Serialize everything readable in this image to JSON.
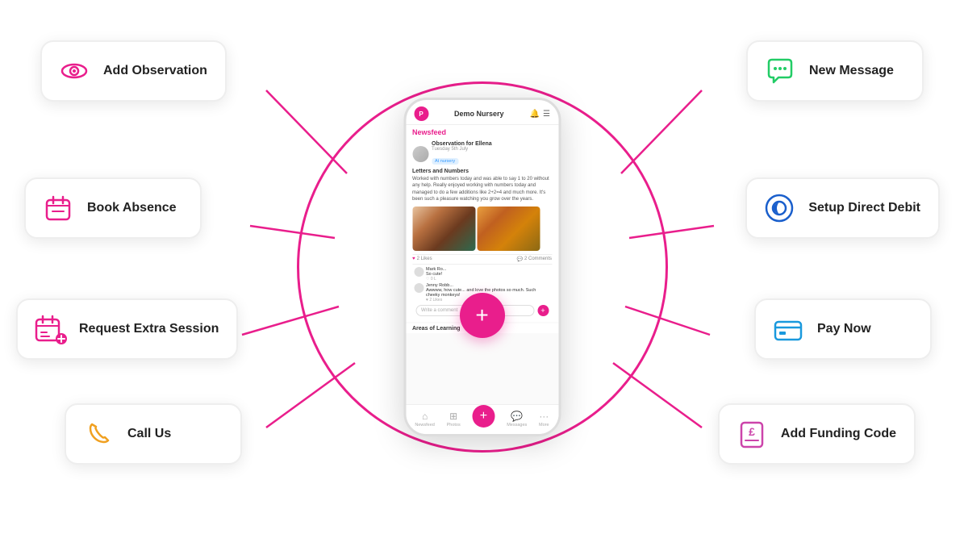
{
  "app": {
    "title": "Demo Nursery",
    "logo": "P"
  },
  "phone": {
    "newsfeed_label": "Newsfeed",
    "observation": {
      "name": "Observation for Ellena",
      "date": "Tuesday 5th July",
      "tag": "At nursery",
      "title": "Letters and Numbers",
      "text": "Worked with numbers today and was able to say 1 to 20 without any help. Really enjoyed working with numbers today and managed to do a few additions like 2+2=4 and much more. It's been such a pleasure watching you grow over the years.",
      "likes": "2 Likes",
      "comments": "2 Comments"
    },
    "comments": [
      {
        "author": "Mark Ro...",
        "text": "So cute!"
      },
      {
        "author": "Jenny Robb...",
        "text": "Awwww, how cute... and love the photos so much. Such cheeky monkeys!",
        "likes": "2 Likes"
      }
    ],
    "write_comment_placeholder": "Write a comment",
    "areas_label": "Areas of Learning",
    "footer": [
      {
        "label": "Newsfeed",
        "icon": "🏠"
      },
      {
        "label": "Photos",
        "icon": "🖼"
      },
      {
        "label": "+",
        "icon": "+"
      },
      {
        "label": "Messages",
        "icon": "💬"
      },
      {
        "label": "More",
        "icon": "···"
      }
    ]
  },
  "action_cards": {
    "add_observation": {
      "label": "Add Observation",
      "icon_type": "eye",
      "position": "left-top"
    },
    "book_absence": {
      "label": "Book Absence",
      "icon_type": "calendar",
      "position": "left-mid"
    },
    "request_session": {
      "label": "Request Extra Session",
      "icon_type": "calendar-extra",
      "position": "left-bot"
    },
    "call_us": {
      "label": "Call Us",
      "icon_type": "phone",
      "position": "left-btm"
    },
    "new_message": {
      "label": "New Message",
      "icon_type": "message",
      "position": "right-top"
    },
    "setup_debit": {
      "label": "Setup Direct Debit",
      "icon_type": "bank",
      "position": "right-mid"
    },
    "pay_now": {
      "label": "Pay Now",
      "icon_type": "card",
      "position": "right-bot"
    },
    "funding_code": {
      "label": "Add Funding Code",
      "icon_type": "funding",
      "position": "right-btm"
    }
  },
  "colors": {
    "pink": "#e91e8c",
    "green": "#22cc66",
    "blue_dark": "#1a5fcc",
    "blue_light": "#1a99dd",
    "purple": "#cc44aa",
    "orange": "#f0a020"
  }
}
